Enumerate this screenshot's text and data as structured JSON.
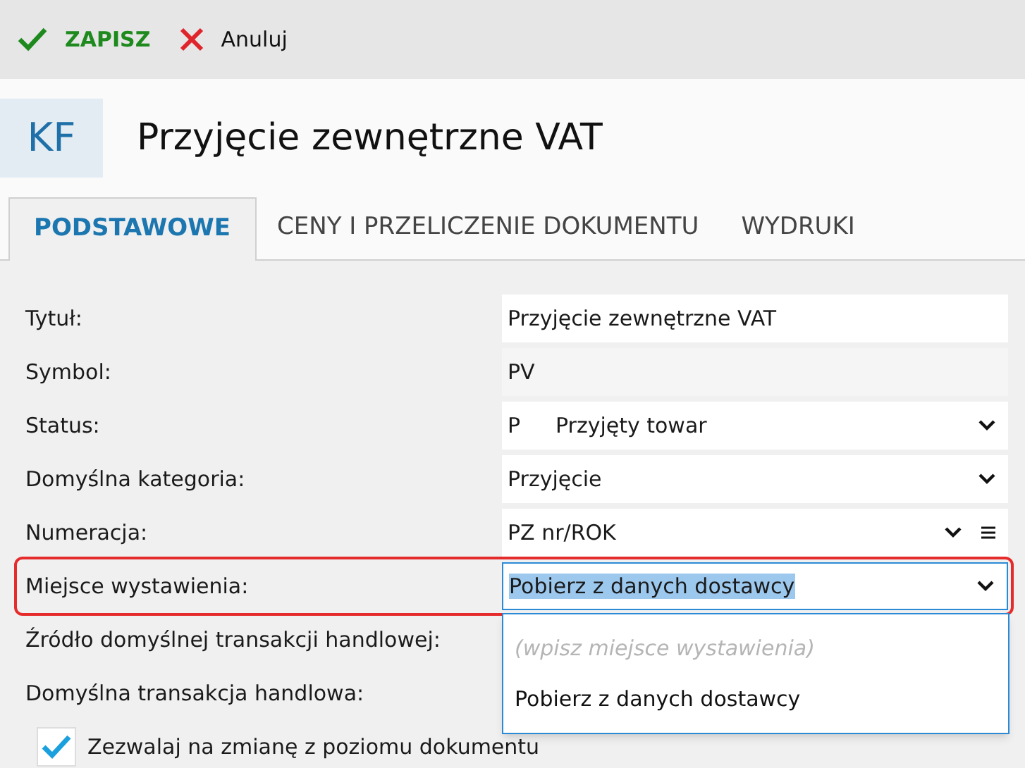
{
  "toolbar": [
    {
      "kind": "save",
      "label": "ZAPISZ"
    },
    {
      "kind": "cancel",
      "label": "Anuluj"
    }
  ],
  "header": {
    "badge": "KF",
    "title": "Przyjęcie zewnętrzne VAT"
  },
  "tabs": [
    {
      "label": "PODSTAWOWE",
      "selected": true
    },
    {
      "label": "CENY I PRZELICZENIE DOKUMENTU",
      "selected": false
    },
    {
      "label": "WYDRUKI",
      "selected": false
    }
  ],
  "fields": [
    {
      "label": "Tytuł:",
      "kind": "text",
      "value": "Przyjęcie zewnętrzne VAT"
    },
    {
      "label": "Symbol:",
      "kind": "readonly",
      "value": "PV"
    },
    {
      "label": "Status:",
      "kind": "select",
      "code": "P",
      "value": "Przyjęty towar"
    },
    {
      "label": "Domyślna kategoria:",
      "kind": "select",
      "value": "Przyjęcie"
    },
    {
      "label": "Numeracja:",
      "kind": "select_menu",
      "value": "PZ nr/ROK"
    },
    {
      "label": "Miejsce wystawienia:",
      "kind": "combo",
      "value": "Pobierz z danych dostawcy",
      "highlighted": true,
      "open": true,
      "options": [
        {
          "kind": "hint",
          "text": "(wpisz miejsce wystawienia)"
        },
        {
          "kind": "option",
          "text": "Pobierz z danych dostawcy"
        }
      ]
    },
    {
      "label": "Źródło domyślnej transakcji handlowej:",
      "kind": "hidden"
    },
    {
      "label": "Domyślna transakcja handlowa:",
      "kind": "hidden"
    }
  ],
  "checkbox": {
    "label": "Zezwalaj na zmianę z poziomu dokumentu",
    "checked": true
  }
}
